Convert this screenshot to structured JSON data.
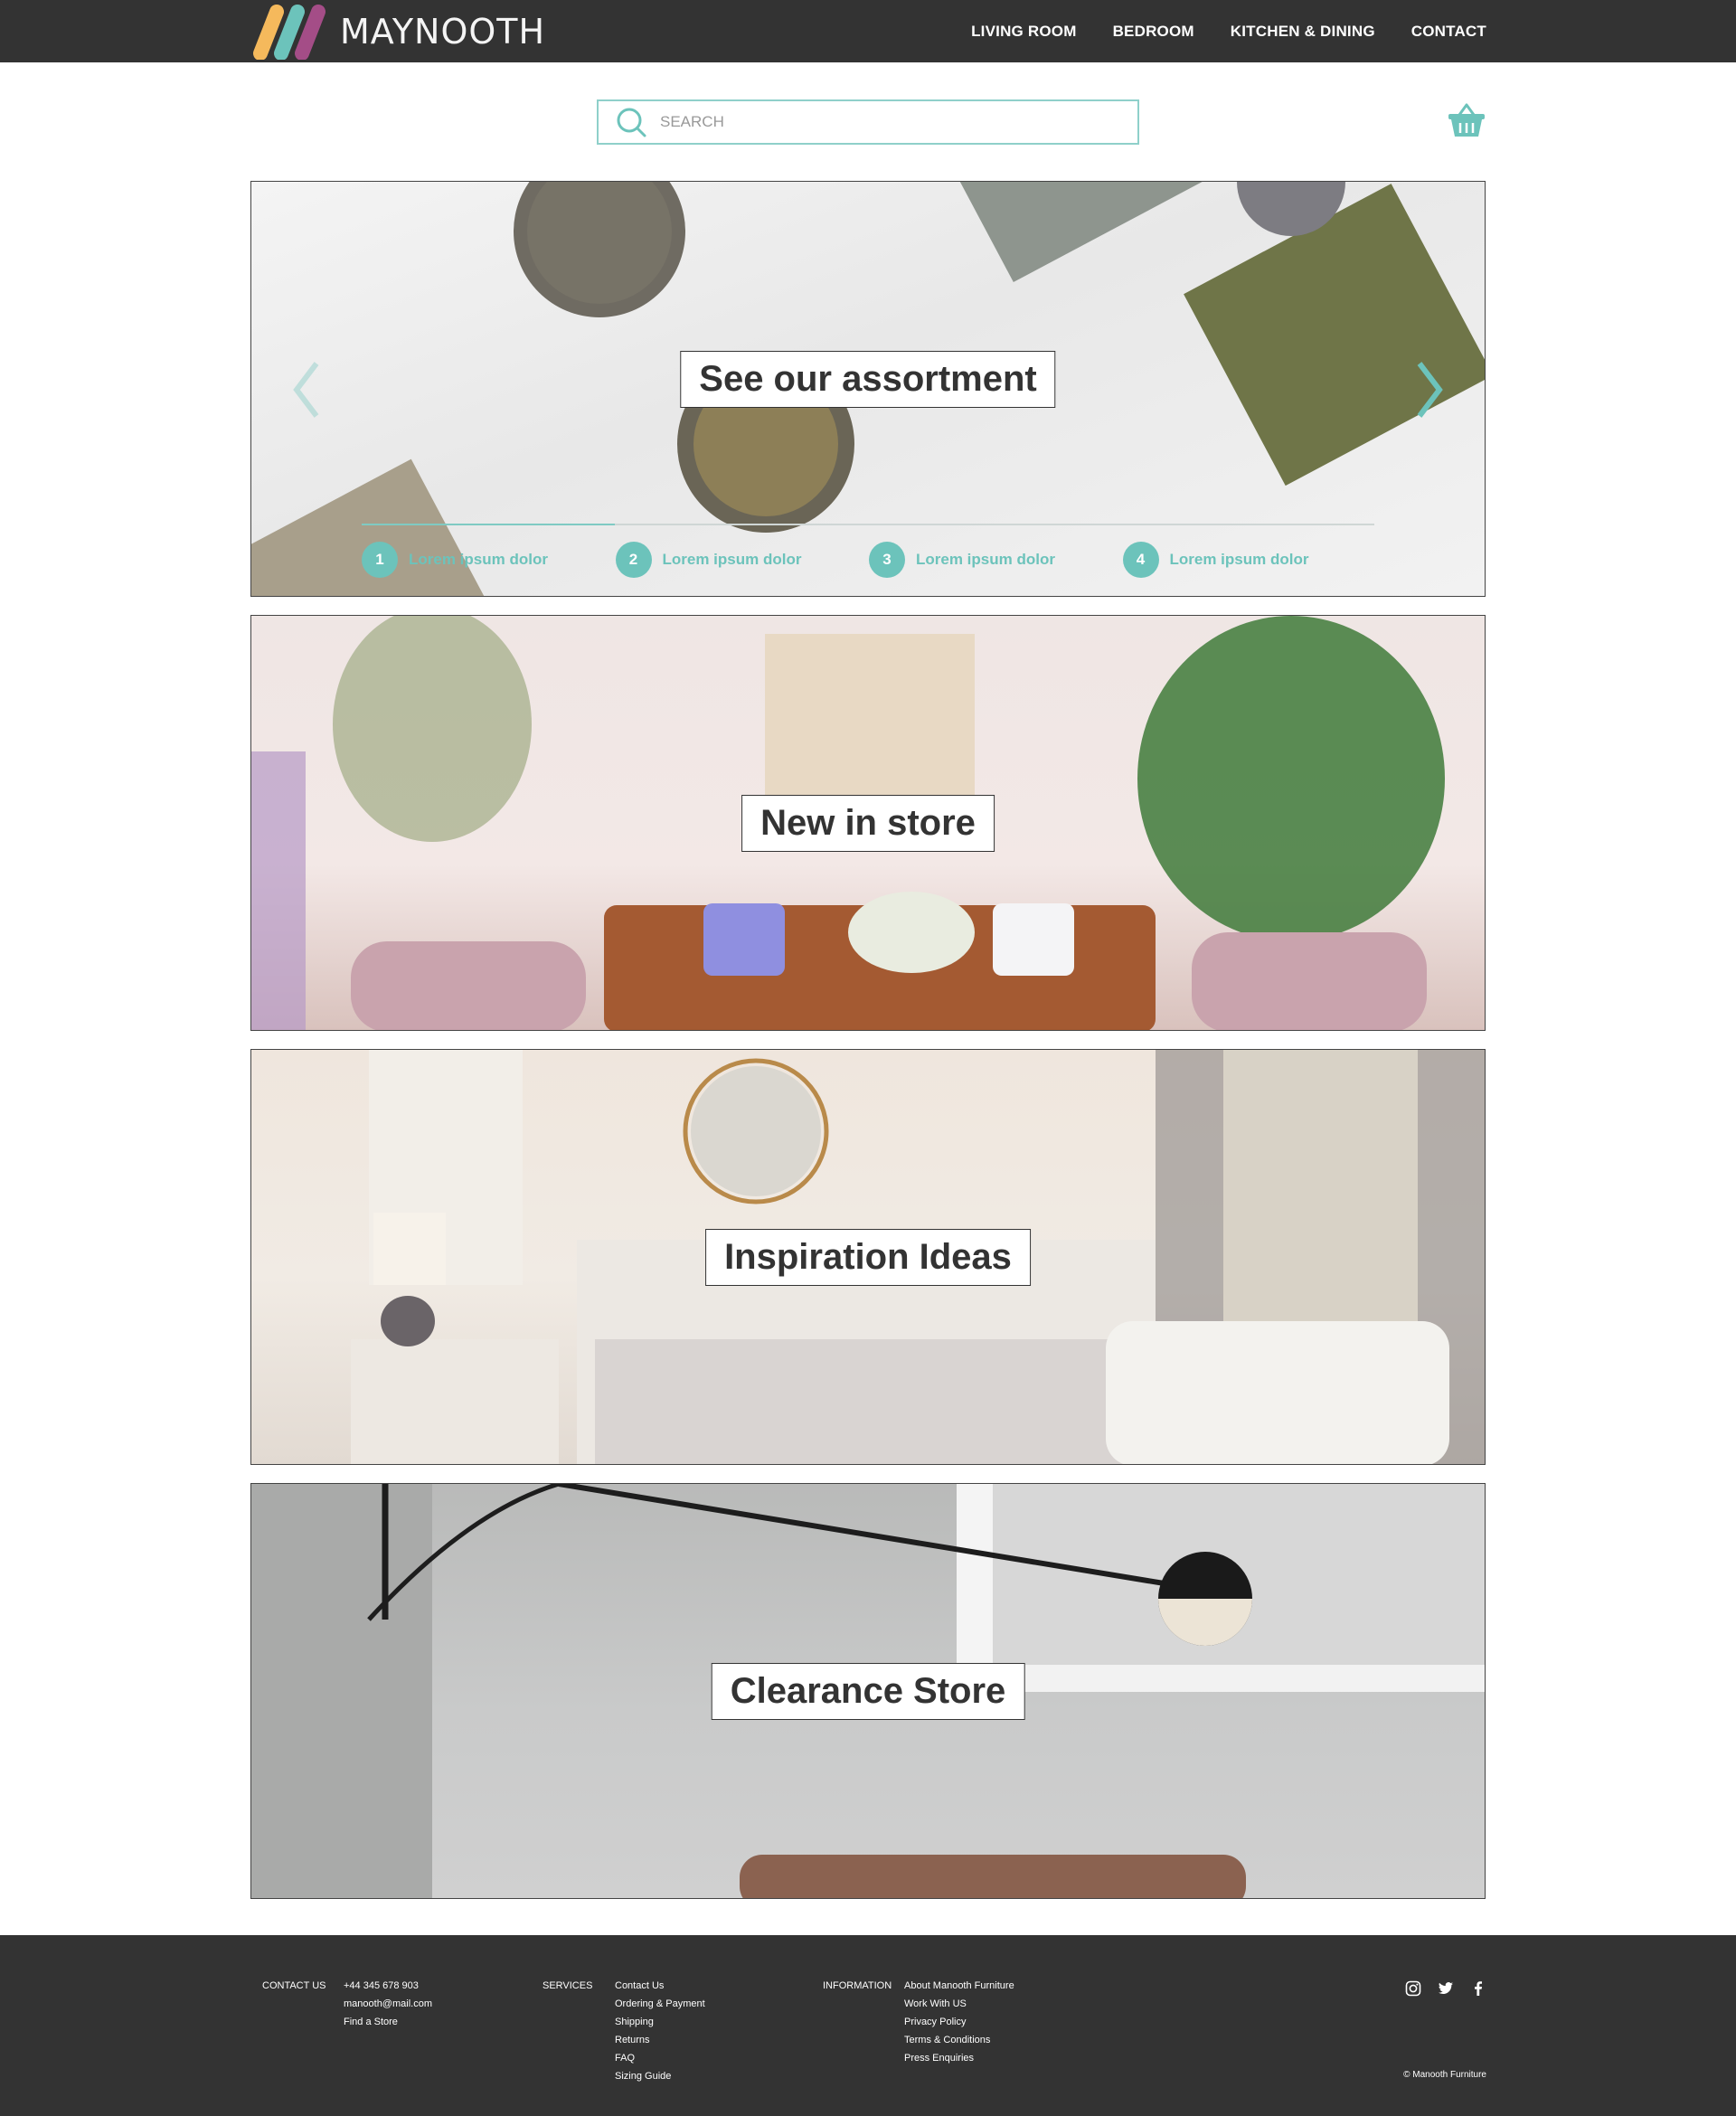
{
  "brand": {
    "name": "MAYNOOTH",
    "logo_colors": [
      "#f5b95c",
      "#6cc3bb",
      "#a44d87"
    ]
  },
  "nav": {
    "items": [
      {
        "label": "LIVING ROOM"
      },
      {
        "label": "BEDROOM"
      },
      {
        "label": "KITCHEN & DINING"
      },
      {
        "label": "CONTACT"
      }
    ]
  },
  "search": {
    "placeholder": "SEARCH",
    "icon": "search-icon"
  },
  "cart": {
    "icon": "basket-icon"
  },
  "hero": {
    "label": "See our assortment",
    "prev_icon": "chevron-left-icon",
    "next_icon": "chevron-right-icon",
    "progress": 0.25,
    "steps": [
      {
        "number": "1",
        "label": "Lorem ipsum dolor"
      },
      {
        "number": "2",
        "label": "Lorem ipsum dolor"
      },
      {
        "number": "3",
        "label": "Lorem ipsum dolor"
      },
      {
        "number": "4",
        "label": "Lorem ipsum dolor"
      }
    ]
  },
  "panels": [
    {
      "label": "New in store"
    },
    {
      "label": "Inspiration Ideas"
    },
    {
      "label": "Clearance Store"
    }
  ],
  "footer": {
    "contact": {
      "heading": "CONTACT US",
      "items": [
        "+44 345 678 903",
        "manooth@mail.com",
        "Find a Store"
      ]
    },
    "services": {
      "heading": "SERVICES",
      "items": [
        "Contact Us",
        "Ordering & Payment",
        "Shipping",
        "Returns",
        "FAQ",
        "Sizing Guide"
      ]
    },
    "information": {
      "heading": "INFORMATION",
      "items": [
        "About Manooth Furniture",
        "Work With US",
        "Privacy Policy",
        "Terms & Conditions",
        "Press Enquiries"
      ]
    },
    "social": [
      "instagram-icon",
      "twitter-icon",
      "facebook-icon"
    ],
    "copyright": "© Manooth Furniture"
  },
  "colors": {
    "header_bg": "#333333",
    "accent": "#6cc3bb",
    "footer_bg": "#333333"
  }
}
